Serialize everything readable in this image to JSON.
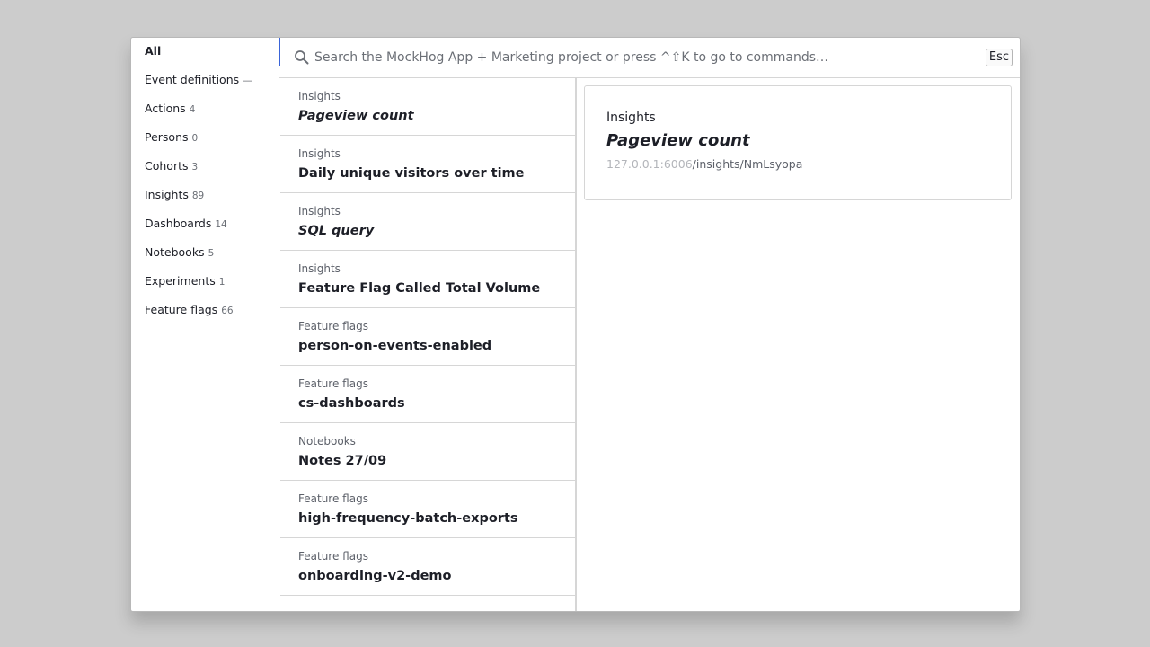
{
  "tabs": [
    {
      "label": "All",
      "count": "",
      "active": true
    },
    {
      "label": "Event definitions",
      "count": "—"
    },
    {
      "label": "Actions",
      "count": "4"
    },
    {
      "label": "Persons",
      "count": "0"
    },
    {
      "label": "Cohorts",
      "count": "3"
    },
    {
      "label": "Insights",
      "count": "89"
    },
    {
      "label": "Dashboards",
      "count": "14"
    },
    {
      "label": "Notebooks",
      "count": "5"
    },
    {
      "label": "Experiments",
      "count": "1"
    },
    {
      "label": "Feature flags",
      "count": "66"
    }
  ],
  "search": {
    "placeholder": "Search the MockHog App + Marketing project or press ^⇧K to go to commands…",
    "value": "",
    "esc_label": "Esc"
  },
  "results": [
    {
      "type": "Insights",
      "name": "Pageview count",
      "italic": true
    },
    {
      "type": "Insights",
      "name": "Daily unique visitors over time",
      "italic": false
    },
    {
      "type": "Insights",
      "name": "SQL query",
      "italic": true
    },
    {
      "type": "Insights",
      "name": "Feature Flag Called Total Volume",
      "italic": false
    },
    {
      "type": "Feature flags",
      "name": "person-on-events-enabled",
      "italic": false
    },
    {
      "type": "Feature flags",
      "name": "cs-dashboards",
      "italic": false
    },
    {
      "type": "Notebooks",
      "name": "Notes 27/09",
      "italic": false
    },
    {
      "type": "Feature flags",
      "name": "high-frequency-batch-exports",
      "italic": false
    },
    {
      "type": "Feature flags",
      "name": "onboarding-v2-demo",
      "italic": false
    }
  ],
  "preview": {
    "type": "Insights",
    "name": "Pageview count",
    "url_host": "127.0.0.1:6006",
    "url_path": "/insights/NmLsyopa"
  },
  "colors": {
    "accent": "#3a64d8",
    "backdrop": "#cccccc",
    "text": "#1d1f27",
    "muted": "#6b6f76"
  }
}
